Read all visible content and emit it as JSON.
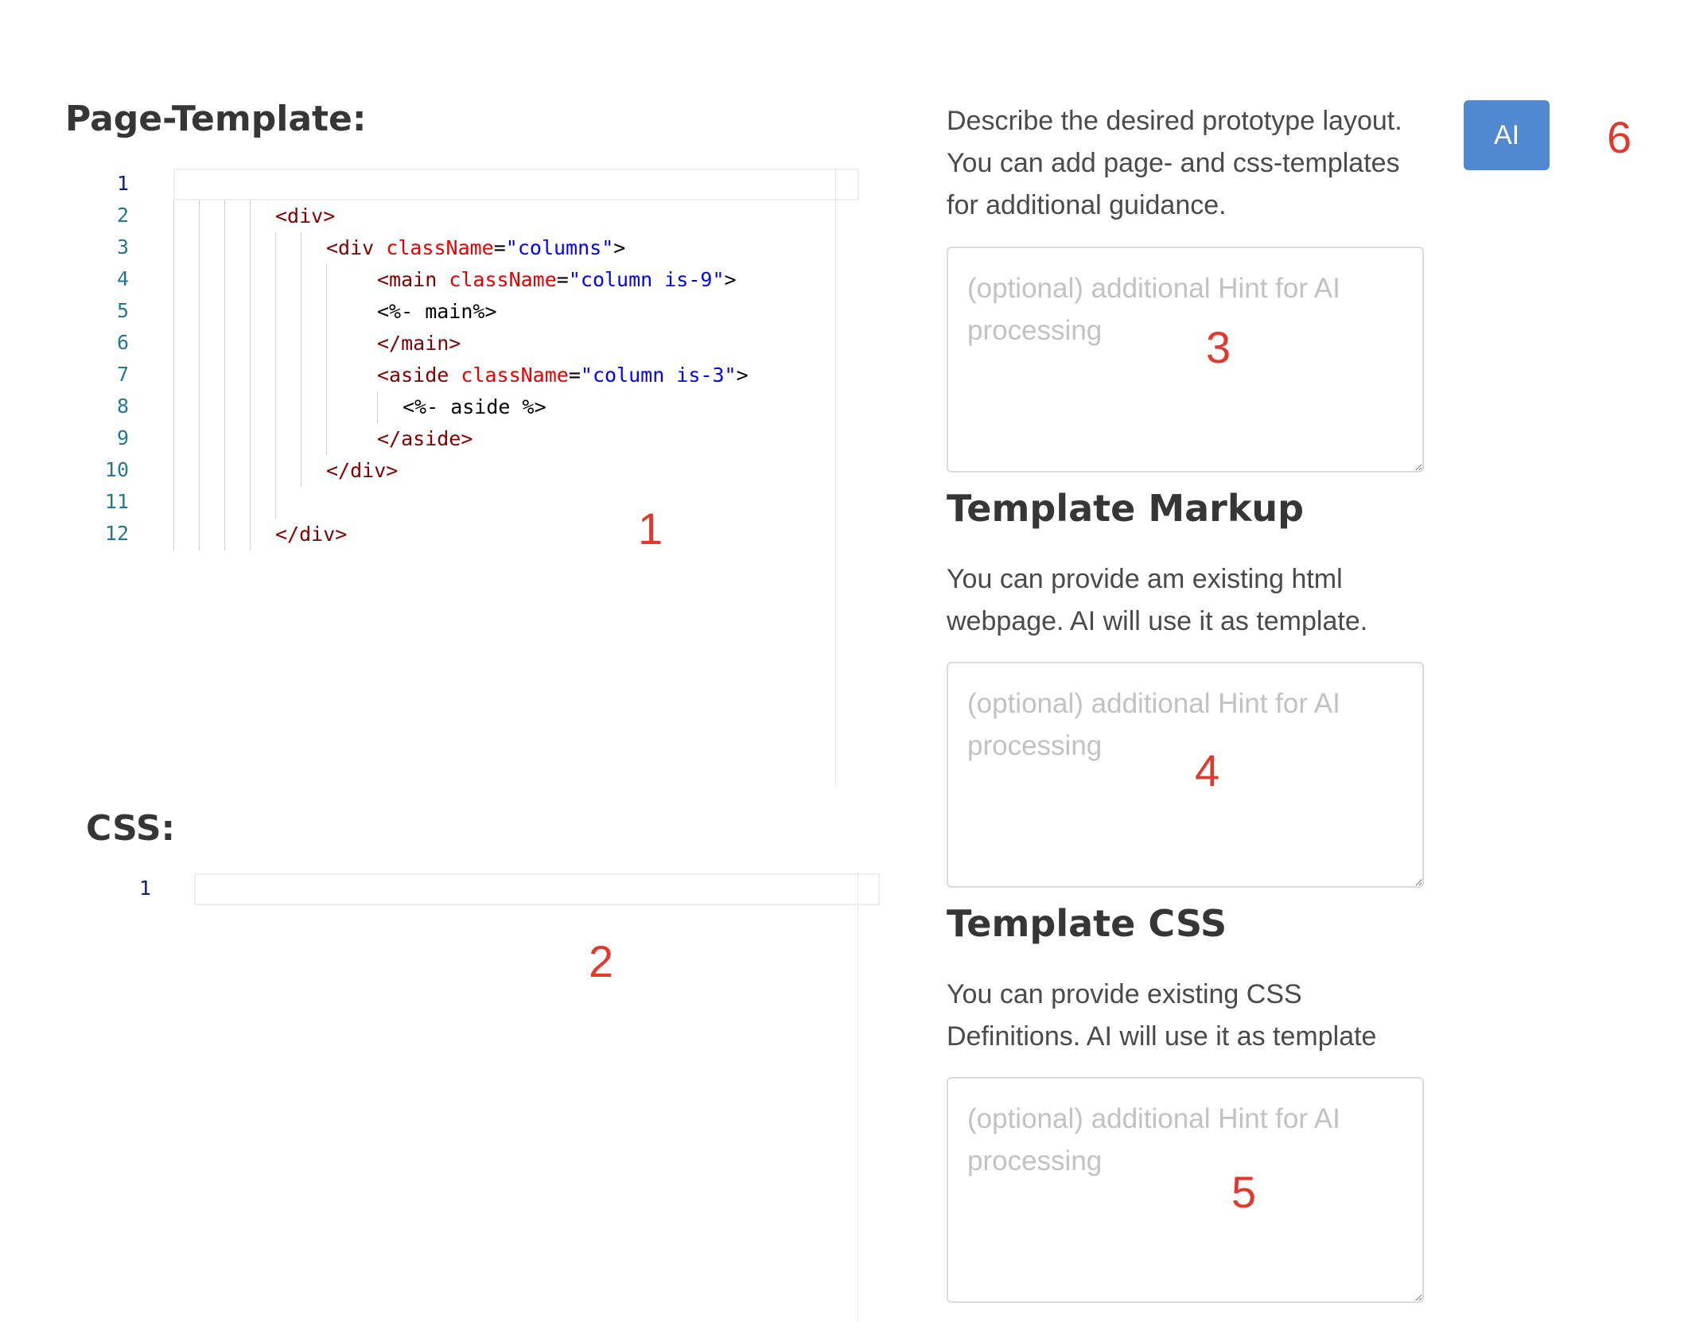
{
  "page_template": {
    "title": "Page-Template:",
    "line_numbers": [
      "1",
      "2",
      "3",
      "4",
      "5",
      "6",
      "7",
      "8",
      "9",
      "10",
      "11",
      "12"
    ],
    "code": {
      "l2": {
        "open": "<div>"
      },
      "l3": {
        "tag": "<div",
        "attr": " className",
        "eq": "=",
        "str": "\"columns\"",
        "close": ">"
      },
      "l4": {
        "tag": "<main",
        "attr": " className",
        "eq": "=",
        "str": "\"column is-9\"",
        "close": ">"
      },
      "l5": {
        "text": "<%- main%>"
      },
      "l6": {
        "tag": "</main>"
      },
      "l7": {
        "tag": "<aside",
        "attr": " className",
        "eq": "=",
        "str": "\"column is-3\"",
        "close": ">"
      },
      "l8": {
        "text": "<%- aside %>"
      },
      "l9": {
        "tag": "</aside>"
      },
      "l10": {
        "tag": "</div>"
      },
      "l12": {
        "tag": "</div>"
      }
    },
    "annotation": "1"
  },
  "css_editor": {
    "title": "CSS:",
    "line_numbers": [
      "1"
    ],
    "annotation": "2"
  },
  "prompt": {
    "description": "Describe the desired prototype layout. You can add page- and css-templates for additional guidance.",
    "placeholder": "(optional) additional Hint for AI processing",
    "annotation": "3"
  },
  "template_markup": {
    "heading": "Template Markup",
    "description": "You can provide am existing html webpage. AI will use it as template.",
    "placeholder": "(optional) additional Hint for AI processing",
    "annotation": "4"
  },
  "template_css": {
    "heading": "Template CSS",
    "description": "You can provide existing CSS Definitions. AI will use it as template",
    "placeholder": "(optional) additional Hint for AI processing",
    "annotation": "5"
  },
  "ai_button": {
    "label": "AI",
    "annotation": "6"
  },
  "colors": {
    "button": "#5089d0",
    "annotation": "#e03a2f",
    "tag": "#800000",
    "attribute": "#e50000",
    "string": "#0000ff"
  }
}
